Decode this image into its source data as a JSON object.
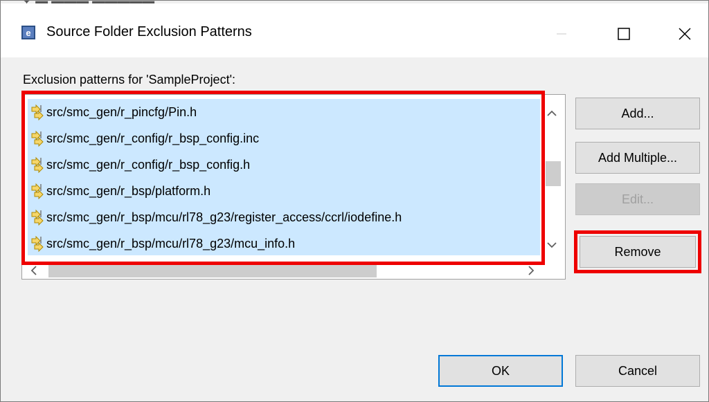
{
  "window": {
    "title": "Source Folder Exclusion Patterns",
    "app_icon": "eclipse-e-icon",
    "controls": [
      "minimize-icon",
      "maximize-icon",
      "close-icon"
    ],
    "top_clipped_text": "✦ ▬ ▬▬▬ ▬▬▬▬▬"
  },
  "section_label": "Exclusion patterns for 'SampleProject':",
  "patterns": [
    "src/smc_gen/r_pincfg/Pin.h",
    "src/smc_gen/r_config/r_bsp_config.inc",
    "src/smc_gen/r_config/r_bsp_config.h",
    "src/smc_gen/r_bsp/platform.h",
    "src/smc_gen/r_bsp/mcu/rl78_g23/register_access/ccrl/iodefine.h",
    "src/smc_gen/r_bsp/mcu/rl78_g23/mcu_info.h"
  ],
  "buttons": {
    "add": "Add...",
    "add_multiple": "Add Multiple...",
    "edit": "Edit...",
    "remove": "Remove",
    "ok": "OK",
    "cancel": "Cancel"
  },
  "colors": {
    "highlight": "#ee0000",
    "selection": "#cce8ff"
  }
}
